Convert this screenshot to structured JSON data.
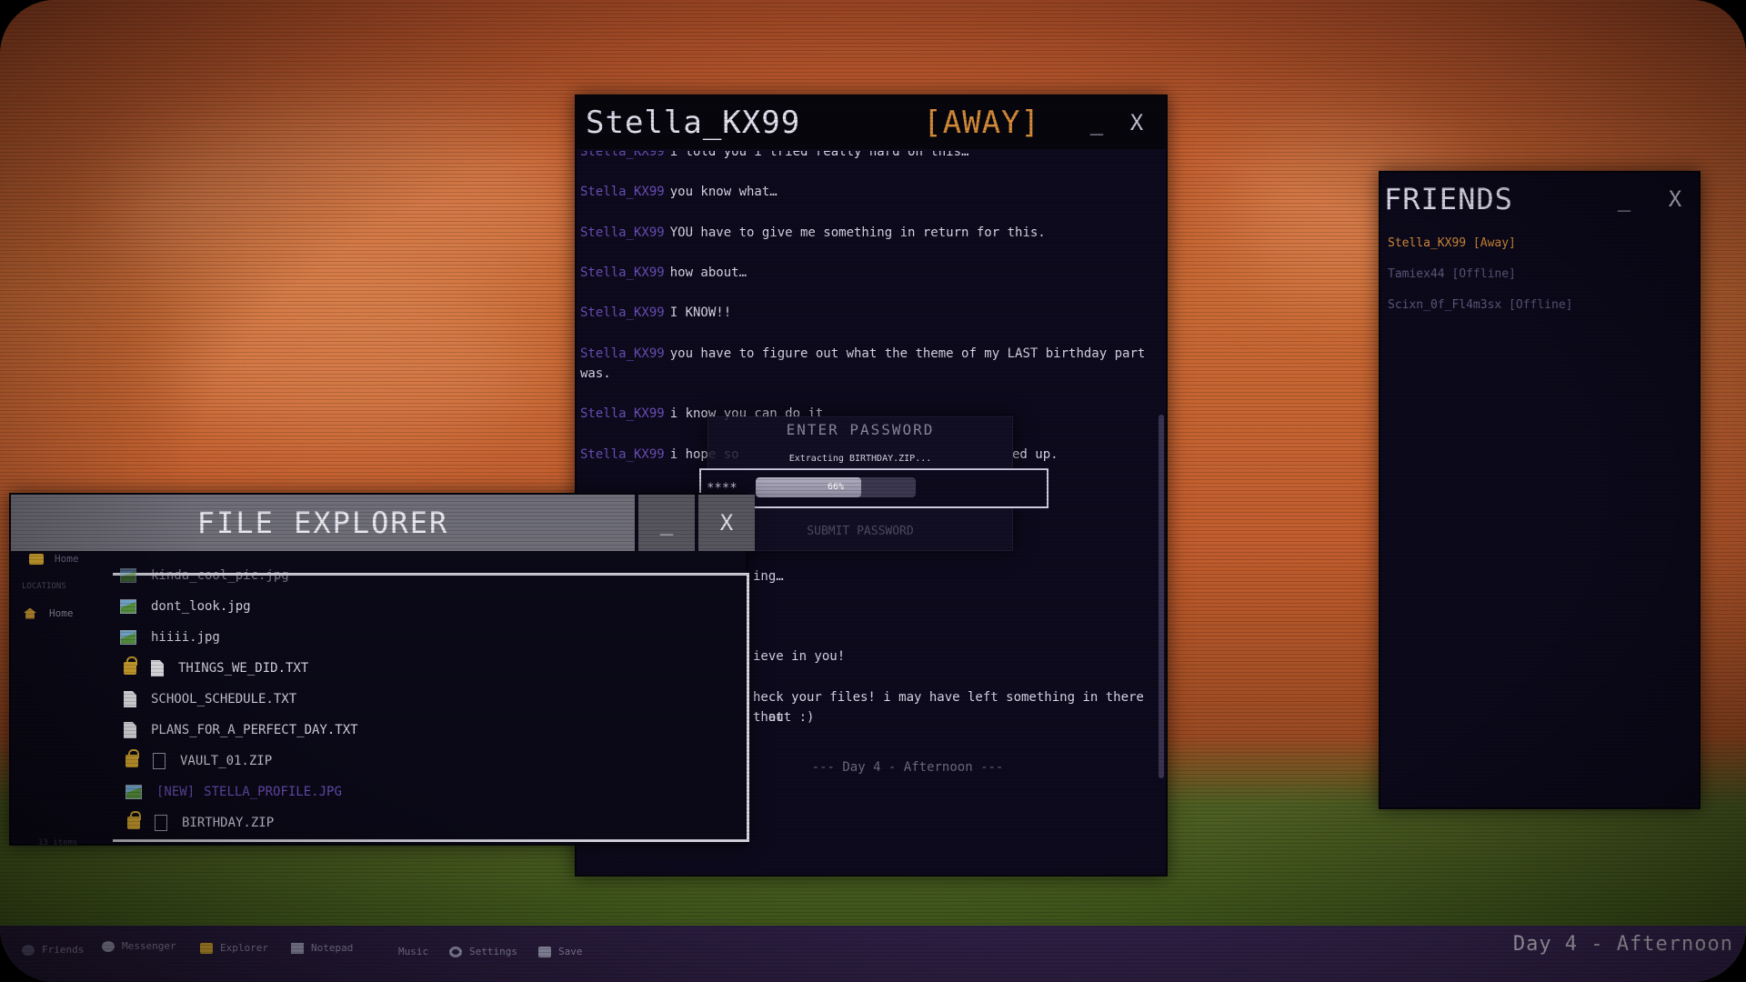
{
  "chat": {
    "title": "Stella_KX99",
    "status": "[AWAY]",
    "minimize": "_",
    "close": "X",
    "messages": [
      {
        "sender": "Stella_KX99",
        "text": "i told you i tried really hard on this…"
      },
      {
        "sender": "Stella_KX99",
        "text": "you know what…"
      },
      {
        "sender": "Stella_KX99",
        "text": "YOU have to give me something in return for this."
      },
      {
        "sender": "Stella_KX99",
        "text": "how about…"
      },
      {
        "sender": "Stella_KX99",
        "text": "I KNOW!!"
      },
      {
        "sender": "Stella_KX99",
        "text": "you have to figure out what the theme of my LAST birthday part was."
      },
      {
        "sender": "Stella_KX99",
        "text": "i know you can do it"
      },
      {
        "sender": "Stella_KX99",
        "text": "i hope so"
      }
    ],
    "partial_right": [
      {
        "text": "ed up."
      },
      {
        "text": "ing…"
      },
      {
        "text": "ieve in you!"
      },
      {
        "text": "heck your files! i may have left something in there that"
      },
      {
        "text": "t out :)"
      }
    ],
    "divider": "--- Day 4 - Afternoon ---"
  },
  "password_dialog": {
    "title": "ENTER PASSWORD",
    "extracting": "Extracting BIRTHDAY.ZIP...",
    "masked_value": "****",
    "progress_percent": 66,
    "progress_label": "66%",
    "button_label": "SUBMIT PASSWORD"
  },
  "file_explorer": {
    "title": "FILE EXPLORER",
    "minimize": "_",
    "close": "X",
    "address": "Home",
    "sidebar_header": "LOCATIONS",
    "sidebar_home": "Home",
    "files": [
      {
        "name": "kinda_cool_pic.jpg",
        "type": "image",
        "locked": false,
        "is_new": false
      },
      {
        "name": "dont_look.jpg",
        "type": "image",
        "locked": false,
        "is_new": false
      },
      {
        "name": "hiiii.jpg",
        "type": "image",
        "locked": false,
        "is_new": false
      },
      {
        "name": "THINGS_WE_DID.TXT",
        "type": "text",
        "locked": true,
        "is_new": false
      },
      {
        "name": "SCHOOL_SCHEDULE.TXT",
        "type": "text",
        "locked": false,
        "is_new": false
      },
      {
        "name": "PLANS_FOR_A_PERFECT_DAY.TXT",
        "type": "text",
        "locked": false,
        "is_new": false
      },
      {
        "name": "VAULT_01.ZIP",
        "type": "zip",
        "locked": true,
        "is_new": false
      },
      {
        "name": "STELLA_PROFILE.JPG",
        "type": "image",
        "locked": false,
        "is_new": true,
        "new_tag": "[NEW]"
      },
      {
        "name": "BIRTHDAY.ZIP",
        "type": "zip",
        "locked": true,
        "is_new": false
      }
    ],
    "item_count": "13 items"
  },
  "friends": {
    "title": "FRIENDS",
    "minimize": "_",
    "close": "X",
    "list": [
      {
        "name": "Stella_KX99 [Away]",
        "status": "away"
      },
      {
        "name": "Tamiex44 [Offline]",
        "status": "offline"
      },
      {
        "name": "Scixn_0f_Fl4m3sx [Offline]",
        "status": "offline"
      }
    ]
  },
  "taskbar": {
    "items": [
      {
        "label": "Friends",
        "icon": "friends-icon"
      },
      {
        "label": "Messenger",
        "icon": "eye-icon"
      },
      {
        "label": "Explorer",
        "icon": "folder-icon"
      },
      {
        "label": "Notepad",
        "icon": "notepad-icon"
      },
      {
        "label": "Music",
        "icon": "music-icon"
      },
      {
        "label": "Settings",
        "icon": "gear-icon"
      },
      {
        "label": "Save",
        "icon": "save-icon"
      }
    ],
    "day_label": "Day 4 - Afternoon"
  },
  "colors": {
    "accent_orange": "#d48b3a",
    "sender_violet": "#6b4fb8",
    "window_bg": "#0d0a1d"
  }
}
